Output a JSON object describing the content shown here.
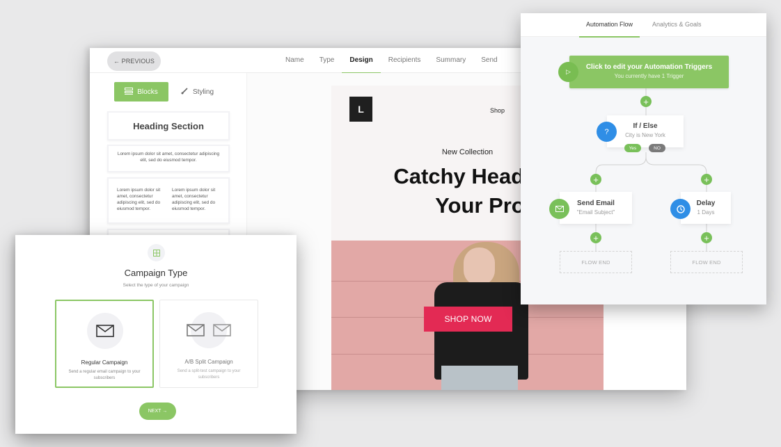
{
  "editor": {
    "previous_label": "← PREVIOUS",
    "steps": [
      {
        "label": "Name",
        "active": false
      },
      {
        "label": "Type",
        "active": false
      },
      {
        "label": "Design",
        "active": true
      },
      {
        "label": "Recipients",
        "active": false
      },
      {
        "label": "Summary",
        "active": false
      },
      {
        "label": "Send",
        "active": false
      }
    ],
    "sidebar": {
      "tabs": [
        {
          "label": "Blocks",
          "icon": "blocks-icon",
          "active": true
        },
        {
          "label": "Styling",
          "icon": "brush-icon",
          "active": false
        }
      ],
      "blocks": {
        "heading": "Heading Section",
        "text_single": "Lorem ipsum dolor sit amet, consectetur adipiscing elit, sed do eiusmod tempor.",
        "text_col_left": "Lorem ipsum dolor sit amet, consectetur adipiscing elit, sed do eiusmod tempor.",
        "text_col_right": "Lorem ipsum dolor sit amet, consectetur adipiscing elit, sed do eiusmod tempor."
      }
    },
    "email": {
      "logo_letter": "L",
      "nav_link": "Shop",
      "eyebrow": "New Collection",
      "headline_line1": "Catchy Headline",
      "headline_line2": "Your Produc",
      "cta_label": "SHOP NOW"
    }
  },
  "flow": {
    "tabs": [
      {
        "label": "Automation Flow",
        "active": true
      },
      {
        "label": "Analytics & Goals",
        "active": false
      }
    ],
    "trigger": {
      "title": "Click to edit your Automation Triggers",
      "subtitle": "You currently have 1 Trigger"
    },
    "condition": {
      "title": "If / Else",
      "subtitle": "City is New York",
      "yes_label": "Yes",
      "no_label": "NO"
    },
    "send_email": {
      "title": "Send Email",
      "subtitle": "\"Email Subject\""
    },
    "delay": {
      "title": "Delay",
      "subtitle": "1 Days"
    },
    "flow_end_label": "FLOW END",
    "plus_symbol": "+",
    "colors": {
      "green": "#8bc664",
      "blue": "#2f8ee6",
      "gray": "#7a7a7a"
    }
  },
  "campaign": {
    "title": "Campaign Type",
    "subtitle": "Select the type of your campaign",
    "options": [
      {
        "title": "Regular Campaign",
        "description": "Send a regular email campaign to your subscribers",
        "selected": true
      },
      {
        "title": "A/B Split Campaign",
        "description": "Send a split-test campaign to your subscribers",
        "selected": false
      }
    ],
    "next_label": "NEXT →"
  }
}
